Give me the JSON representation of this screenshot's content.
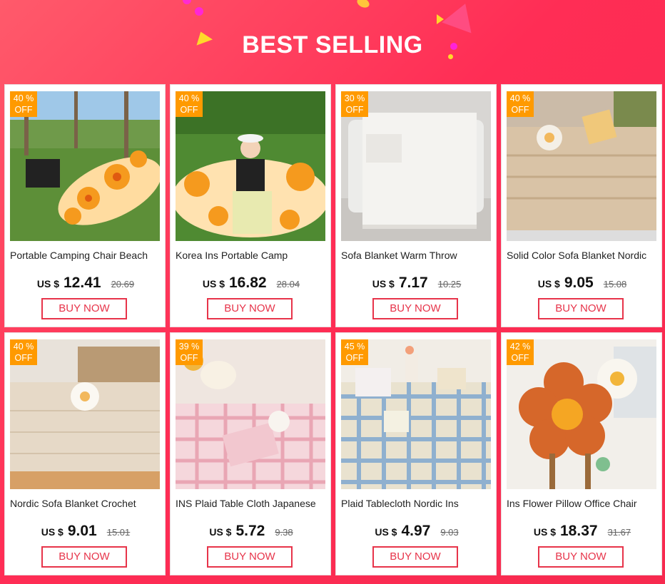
{
  "header": {
    "title": "BEST SELLING"
  },
  "colors": {
    "accent": "#ff2d55",
    "badge": "#ff9a00",
    "button_border": "#e7344a"
  },
  "currency_label": "US $",
  "button_label": "BUY NOW",
  "products": [
    {
      "name": "Portable Camping Chair Beach",
      "discount": "40 %",
      "off": "OFF",
      "price": "12.41",
      "old_price": "20.69",
      "image": "camping-sofa-photo"
    },
    {
      "name": "Korea Ins Portable Camp",
      "discount": "40 %",
      "off": "OFF",
      "price": "16.82",
      "old_price": "28.04",
      "image": "camp-sofa-girl-photo"
    },
    {
      "name": "Sofa Blanket Warm Throw",
      "discount": "30 %",
      "off": "OFF",
      "price": "7.17",
      "old_price": "10.25",
      "image": "white-sofa-blanket-photo"
    },
    {
      "name": "Solid Color Sofa Blanket Nordic",
      "discount": "40 %",
      "off": "OFF",
      "price": "9.05",
      "old_price": "15.08",
      "image": "beige-sofa-blanket-photo"
    },
    {
      "name": "Nordic Sofa Blanket Crochet",
      "discount": "40 %",
      "off": "OFF",
      "price": "9.01",
      "old_price": "15.01",
      "image": "crochet-sofa-blanket-photo"
    },
    {
      "name": "INS Plaid Table Cloth Japanese",
      "discount": "39 %",
      "off": "OFF",
      "price": "5.72",
      "old_price": "9.38",
      "image": "pink-plaid-tablecloth-photo"
    },
    {
      "name": "Plaid Tablecloth Nordic Ins",
      "discount": "45 %",
      "off": "OFF",
      "price": "4.97",
      "old_price": "9.03",
      "image": "blue-plaid-tablecloth-photo"
    },
    {
      "name": "Ins Flower Pillow Office Chair",
      "discount": "42 %",
      "off": "OFF",
      "price": "18.37",
      "old_price": "31.67",
      "image": "flower-pillow-chair-photo"
    }
  ]
}
